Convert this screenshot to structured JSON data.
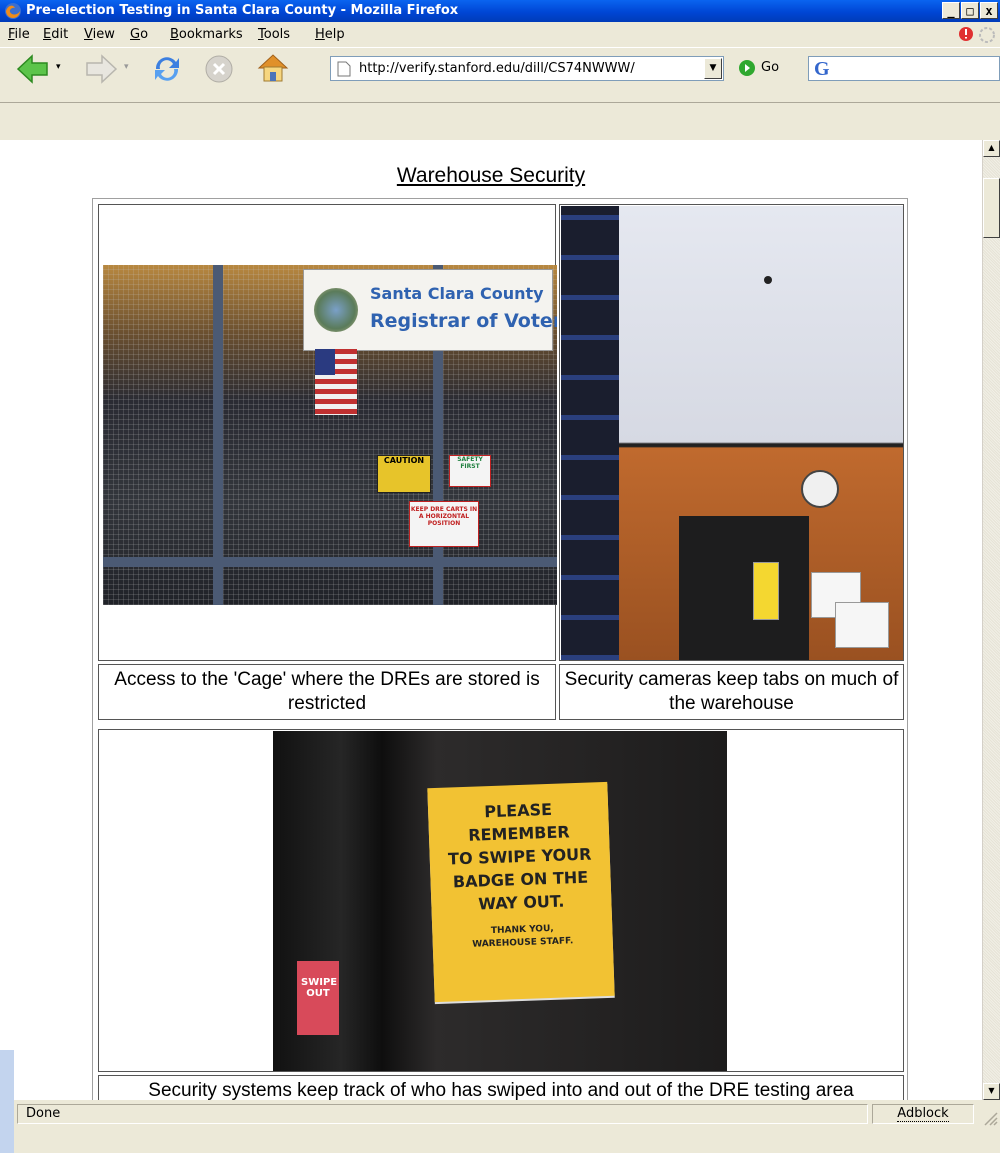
{
  "window": {
    "title": "Pre-election Testing in Santa Clara County - Mozilla Firefox",
    "minimize": "_",
    "maximize": "□",
    "close": "x"
  },
  "menu": {
    "items": [
      {
        "ul": "F",
        "rest": "ile"
      },
      {
        "ul": "E",
        "rest": "dit"
      },
      {
        "ul": "V",
        "rest": "iew"
      },
      {
        "ul": "G",
        "rest": "o"
      },
      {
        "ul": "B",
        "rest": "ookmarks"
      },
      {
        "ul": "T",
        "rest": "ools"
      },
      {
        "ul": "H",
        "rest": "elp"
      }
    ]
  },
  "toolbar": {
    "url": "http://verify.stanford.edu/dill/CS74NWWW/",
    "go_label": "Go",
    "search_logo": "G"
  },
  "page": {
    "heading": "Warehouse Security",
    "caption1": "Access to the 'Cage' where the DREs are stored is restricted",
    "caption2": "Security cameras keep tabs on much of the warehouse",
    "caption3": "Security systems keep track of who has swiped into and out of the DRE testing area"
  },
  "photo1": {
    "sign_line1": "Santa Clara County",
    "sign_line2": "Registrar of Voters",
    "caution": "CAUTION",
    "safety_first": "SAFETY FIRST",
    "keep_dre": "KEEP DRE CARTS IN A HORIZONTAL POSITION"
  },
  "photo3": {
    "poster_l1": "PLEASE REMEMBER",
    "poster_l2": "TO SWIPE YOUR",
    "poster_l3": "BADGE ON THE",
    "poster_l4": "WAY OUT.",
    "poster_l5": "THANK YOU,",
    "poster_l6": "WAREHOUSE STAFF.",
    "swipe": "SWIPE OUT"
  },
  "status": {
    "text": "Done",
    "adblock": "Adblock"
  },
  "colors": {
    "titlebar": "#0046d5",
    "chrome": "#ece9d8",
    "link_green": "#2fa82f"
  }
}
